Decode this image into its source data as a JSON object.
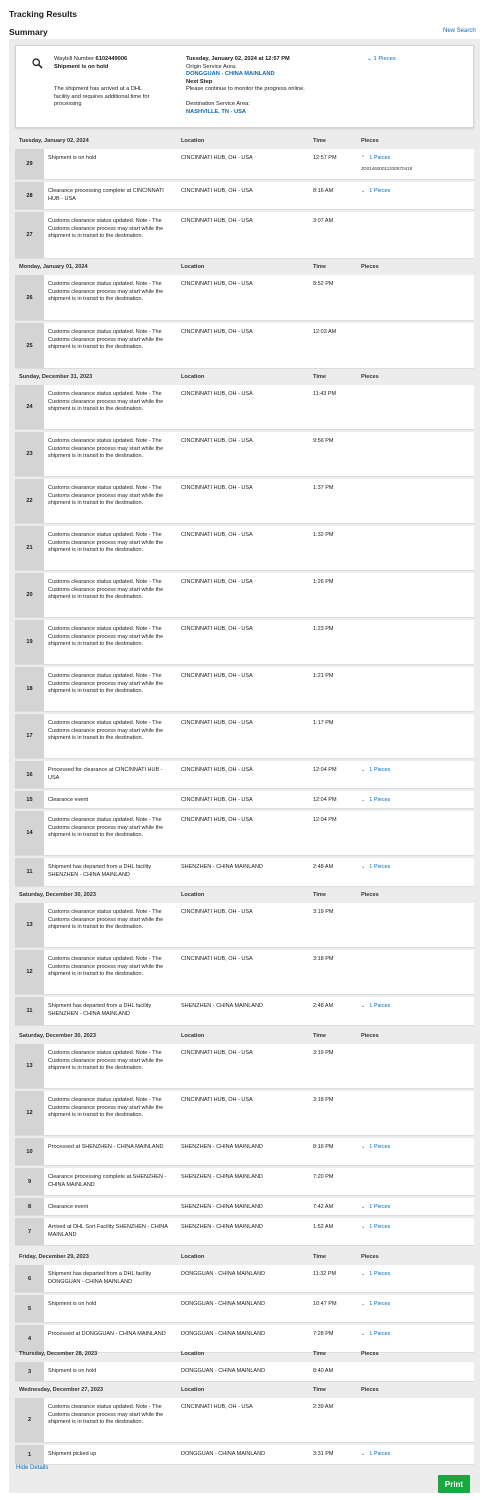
{
  "page": {
    "title": "Tracking Results",
    "summary_heading": "Summary",
    "new_search": "New Search",
    "hide_details": "Hide Details",
    "print": "Print"
  },
  "summary": {
    "waybill_label": "Waybill Number",
    "waybill_number": "6102449006",
    "status": "Shipment is on hold",
    "message": "The shipment has arrived at a DHL facility and requires additional time for processing",
    "datetime": "Tuesday, January 02, 2024 at 12:57 PM",
    "origin_label": "Origin Service Area:",
    "origin": "DONGGUAN - CHINA MAINLAND",
    "next_step_label": "Next Step",
    "next_step": "Please continue to monitor the progress online.",
    "dest_label": "Destination Service Area:",
    "destination": "NASHVILLE, TN - USA",
    "pieces": "1 Pieces"
  },
  "columns": {
    "location": "Location",
    "time": "Time",
    "pieces": "Pieces"
  },
  "sections": [
    {
      "date": "Tuesday, January 02, 2024",
      "rows": [
        {
          "n": "29",
          "desc": "Shipment is on hold",
          "loc": "CINCINNATI HUB, OH - USA",
          "time": "12:57 PM",
          "pieces": "1 Pieces",
          "open": true,
          "piece_id": "JD014600011330970418"
        },
        {
          "n": "28",
          "desc": "Clearance processing complete at CINCINNATI HUB - USA",
          "loc": "CINCINNATI HUB, OH - USA",
          "time": "8:16 AM",
          "pieces": "1 Pieces"
        },
        {
          "n": "27",
          "desc": "Customs clearance status updated. Note - The Customs clearance process may start while the shipment is in transit to the destination.",
          "loc": "CINCINNATI HUB, OH - USA",
          "time": "3:07 AM",
          "pieces": ""
        }
      ]
    },
    {
      "date": "Monday, January 01, 2024",
      "rows": [
        {
          "n": "26",
          "desc": "Customs clearance status updated. Note - The Customs clearance process may start while the shipment is in transit to the destination.",
          "loc": "CINCINNATI HUB, OH - USA",
          "time": "8:52 PM",
          "pieces": ""
        },
        {
          "n": "25",
          "desc": "Customs clearance status updated. Note - The Customs clearance process may start while the shipment is in transit to the destination.",
          "loc": "CINCINNATI HUB, OH - USA",
          "time": "12:03 AM",
          "pieces": ""
        }
      ]
    },
    {
      "date": "Sunday, December 31, 2023",
      "rows": [
        {
          "n": "24",
          "desc": "Customs clearance status updated. Note - The Customs clearance process may start while the shipment is in transit to the destination.",
          "loc": "CINCINNATI HUB, OH - USA",
          "time": "11:43 PM",
          "pieces": ""
        },
        {
          "n": "23",
          "desc": "Customs clearance status updated. Note - The Customs clearance process may start while the shipment is in transit to the destination.",
          "loc": "CINCINNATI HUB, OH - USA",
          "time": "9:56 PM",
          "pieces": ""
        },
        {
          "n": "22",
          "desc": "Customs clearance status updated. Note - The Customs clearance process may start while the shipment is in transit to the destination.",
          "loc": "CINCINNATI HUB, OH - USA",
          "time": "1:37 PM",
          "pieces": ""
        },
        {
          "n": "21",
          "desc": "Customs clearance status updated. Note - The Customs clearance process may start while the shipment is in transit to the destination.",
          "loc": "CINCINNATI HUB, OH - USA",
          "time": "1:32 PM",
          "pieces": ""
        },
        {
          "n": "20",
          "desc": "Customs clearance status updated. Note - The Customs clearance process may start while the shipment is in transit to the destination.",
          "loc": "CINCINNATI HUB, OH - USA",
          "time": "1:26 PM",
          "pieces": ""
        },
        {
          "n": "19",
          "desc": "Customs clearance status updated. Note - The Customs clearance process may start while the shipment is in transit to the destination.",
          "loc": "CINCINNATI HUB, OH - USA",
          "time": "1:23 PM",
          "pieces": ""
        },
        {
          "n": "18",
          "desc": "Customs clearance status updated. Note - The Customs clearance process may start while the shipment is in transit to the destination.",
          "loc": "CINCINNATI HUB, OH - USA",
          "time": "1:21 PM",
          "pieces": ""
        },
        {
          "n": "17",
          "desc": "Customs clearance status updated. Note - The Customs clearance process may start while the shipment is in transit to the destination.",
          "loc": "CINCINNATI HUB, OH - USA",
          "time": "1:17 PM",
          "pieces": ""
        },
        {
          "n": "16",
          "desc": "Processed for clearance at CINCINNATI HUB - USA",
          "loc": "CINCINNATI HUB, OH - USA",
          "time": "12:04 PM",
          "pieces": "1 Pieces"
        },
        {
          "n": "15",
          "desc": "Clearance event",
          "loc": "CINCINNATI HUB, OH - USA",
          "time": "12:04 PM",
          "pieces": "1 Pieces"
        },
        {
          "n": "14",
          "desc": "Customs clearance status updated. Note - The Customs clearance process may start while the shipment is in transit to the destination.",
          "loc": "CINCINNATI HUB, OH - USA",
          "time": "12:04 PM",
          "pieces": ""
        },
        {
          "n": "11",
          "desc": "Shipment has departed from a DHL facility SHENZHEN - CHINA MAINLAND",
          "loc": "SHENZHEN - CHINA MAINLAND",
          "time": "2:48 AM",
          "pieces": "1 Pieces"
        }
      ]
    },
    {
      "date": "Saturday, December 30, 2023",
      "rows": [
        {
          "n": "13",
          "desc": "Customs clearance status updated. Note - The Customs clearance process may start while the shipment is in transit to the destination.",
          "loc": "CINCINNATI HUB, OH - USA",
          "time": "3:19 PM",
          "pieces": ""
        },
        {
          "n": "12",
          "desc": "Customs clearance status updated. Note - The Customs clearance process may start while the shipment is in transit to the destination.",
          "loc": "CINCINNATI HUB, OH - USA",
          "time": "3:18 PM",
          "pieces": ""
        },
        {
          "n": "11",
          "desc": "Shipment has departed from a DHL facility SHENZHEN - CHINA MAINLAND",
          "loc": "SHENZHEN - CHINA MAINLAND",
          "time": "2:48 AM",
          "pieces": "1 Pieces"
        }
      ]
    },
    {
      "date": "Saturday, December 30, 2023",
      "rows": [
        {
          "n": "13",
          "desc": "Customs clearance status updated. Note - The Customs clearance process may start while the shipment is in transit to the destination.",
          "loc": "CINCINNATI HUB, OH - USA",
          "time": "3:19 PM",
          "pieces": ""
        },
        {
          "n": "12",
          "desc": "Customs clearance status updated. Note - The Customs clearance process may start while the shipment is in transit to the destination.",
          "loc": "CINCINNATI HUB, OH - USA",
          "time": "3:18 PM",
          "pieces": ""
        },
        {
          "n": "10",
          "desc": "Processed at SHENZHEN - CHINA MAINLAND",
          "loc": "SHENZHEN - CHINA MAINLAND",
          "time": "8:16 PM",
          "pieces": "1 Pieces"
        },
        {
          "n": "9",
          "desc": "Clearance processing complete at SHENZHEN - CHINA MAINLAND",
          "loc": "SHENZHEN - CHINA MAINLAND",
          "time": "7:20 PM",
          "pieces": ""
        },
        {
          "n": "8",
          "desc": "Clearance event",
          "loc": "SHENZHEN - CHINA MAINLAND",
          "time": "7:42 AM",
          "pieces": "1 Pieces"
        },
        {
          "n": "7",
          "desc": "Arrived at DHL Sort Facility SHENZHEN - CHINA MAINLAND",
          "loc": "SHENZHEN - CHINA MAINLAND",
          "time": "1:52 AM",
          "pieces": "1 Pieces"
        }
      ]
    },
    {
      "date": "Friday, December 29, 2023",
      "rows": [
        {
          "n": "6",
          "desc": "Shipment has departed from a DHL facility DONGGUAN - CHINA MAINLAND",
          "loc": "DONGGUAN - CHINA MAINLAND",
          "time": "11:32 PM",
          "pieces": "1 Pieces"
        },
        {
          "n": "5",
          "desc": "Shipment is on hold",
          "loc": "DONGGUAN - CHINA MAINLAND",
          "time": "10:47 PM",
          "pieces": "1 Pieces"
        },
        {
          "n": "4",
          "desc": "Processed at DONGGUAN - CHINA MAINLAND",
          "loc": "DONGGUAN - CHINA MAINLAND",
          "time": "7:28 PM",
          "pieces": "1 Pieces"
        }
      ]
    },
    {
      "date": "Thursday, December 28, 2023",
      "rows": [
        {
          "n": "3",
          "desc": "Shipment is on hold",
          "loc": "DONGGUAN - CHINA MAINLAND",
          "time": "8:40 AM",
          "pieces": ""
        }
      ]
    },
    {
      "date": "Wednesday, December 27, 2023",
      "rows": [
        {
          "n": "2",
          "desc": "Customs clearance status updated. Note - The Customs clearance process may start while the shipment is in transit to the destination.",
          "loc": "CINCINNATI HUB, OH - USA",
          "time": "2:39 AM",
          "pieces": ""
        },
        {
          "n": "1",
          "desc": "Shipment picked up",
          "loc": "DONGGUAN - CHINA MAINLAND",
          "time": "3:31 PM",
          "pieces": "1 Pieces"
        }
      ]
    }
  ]
}
